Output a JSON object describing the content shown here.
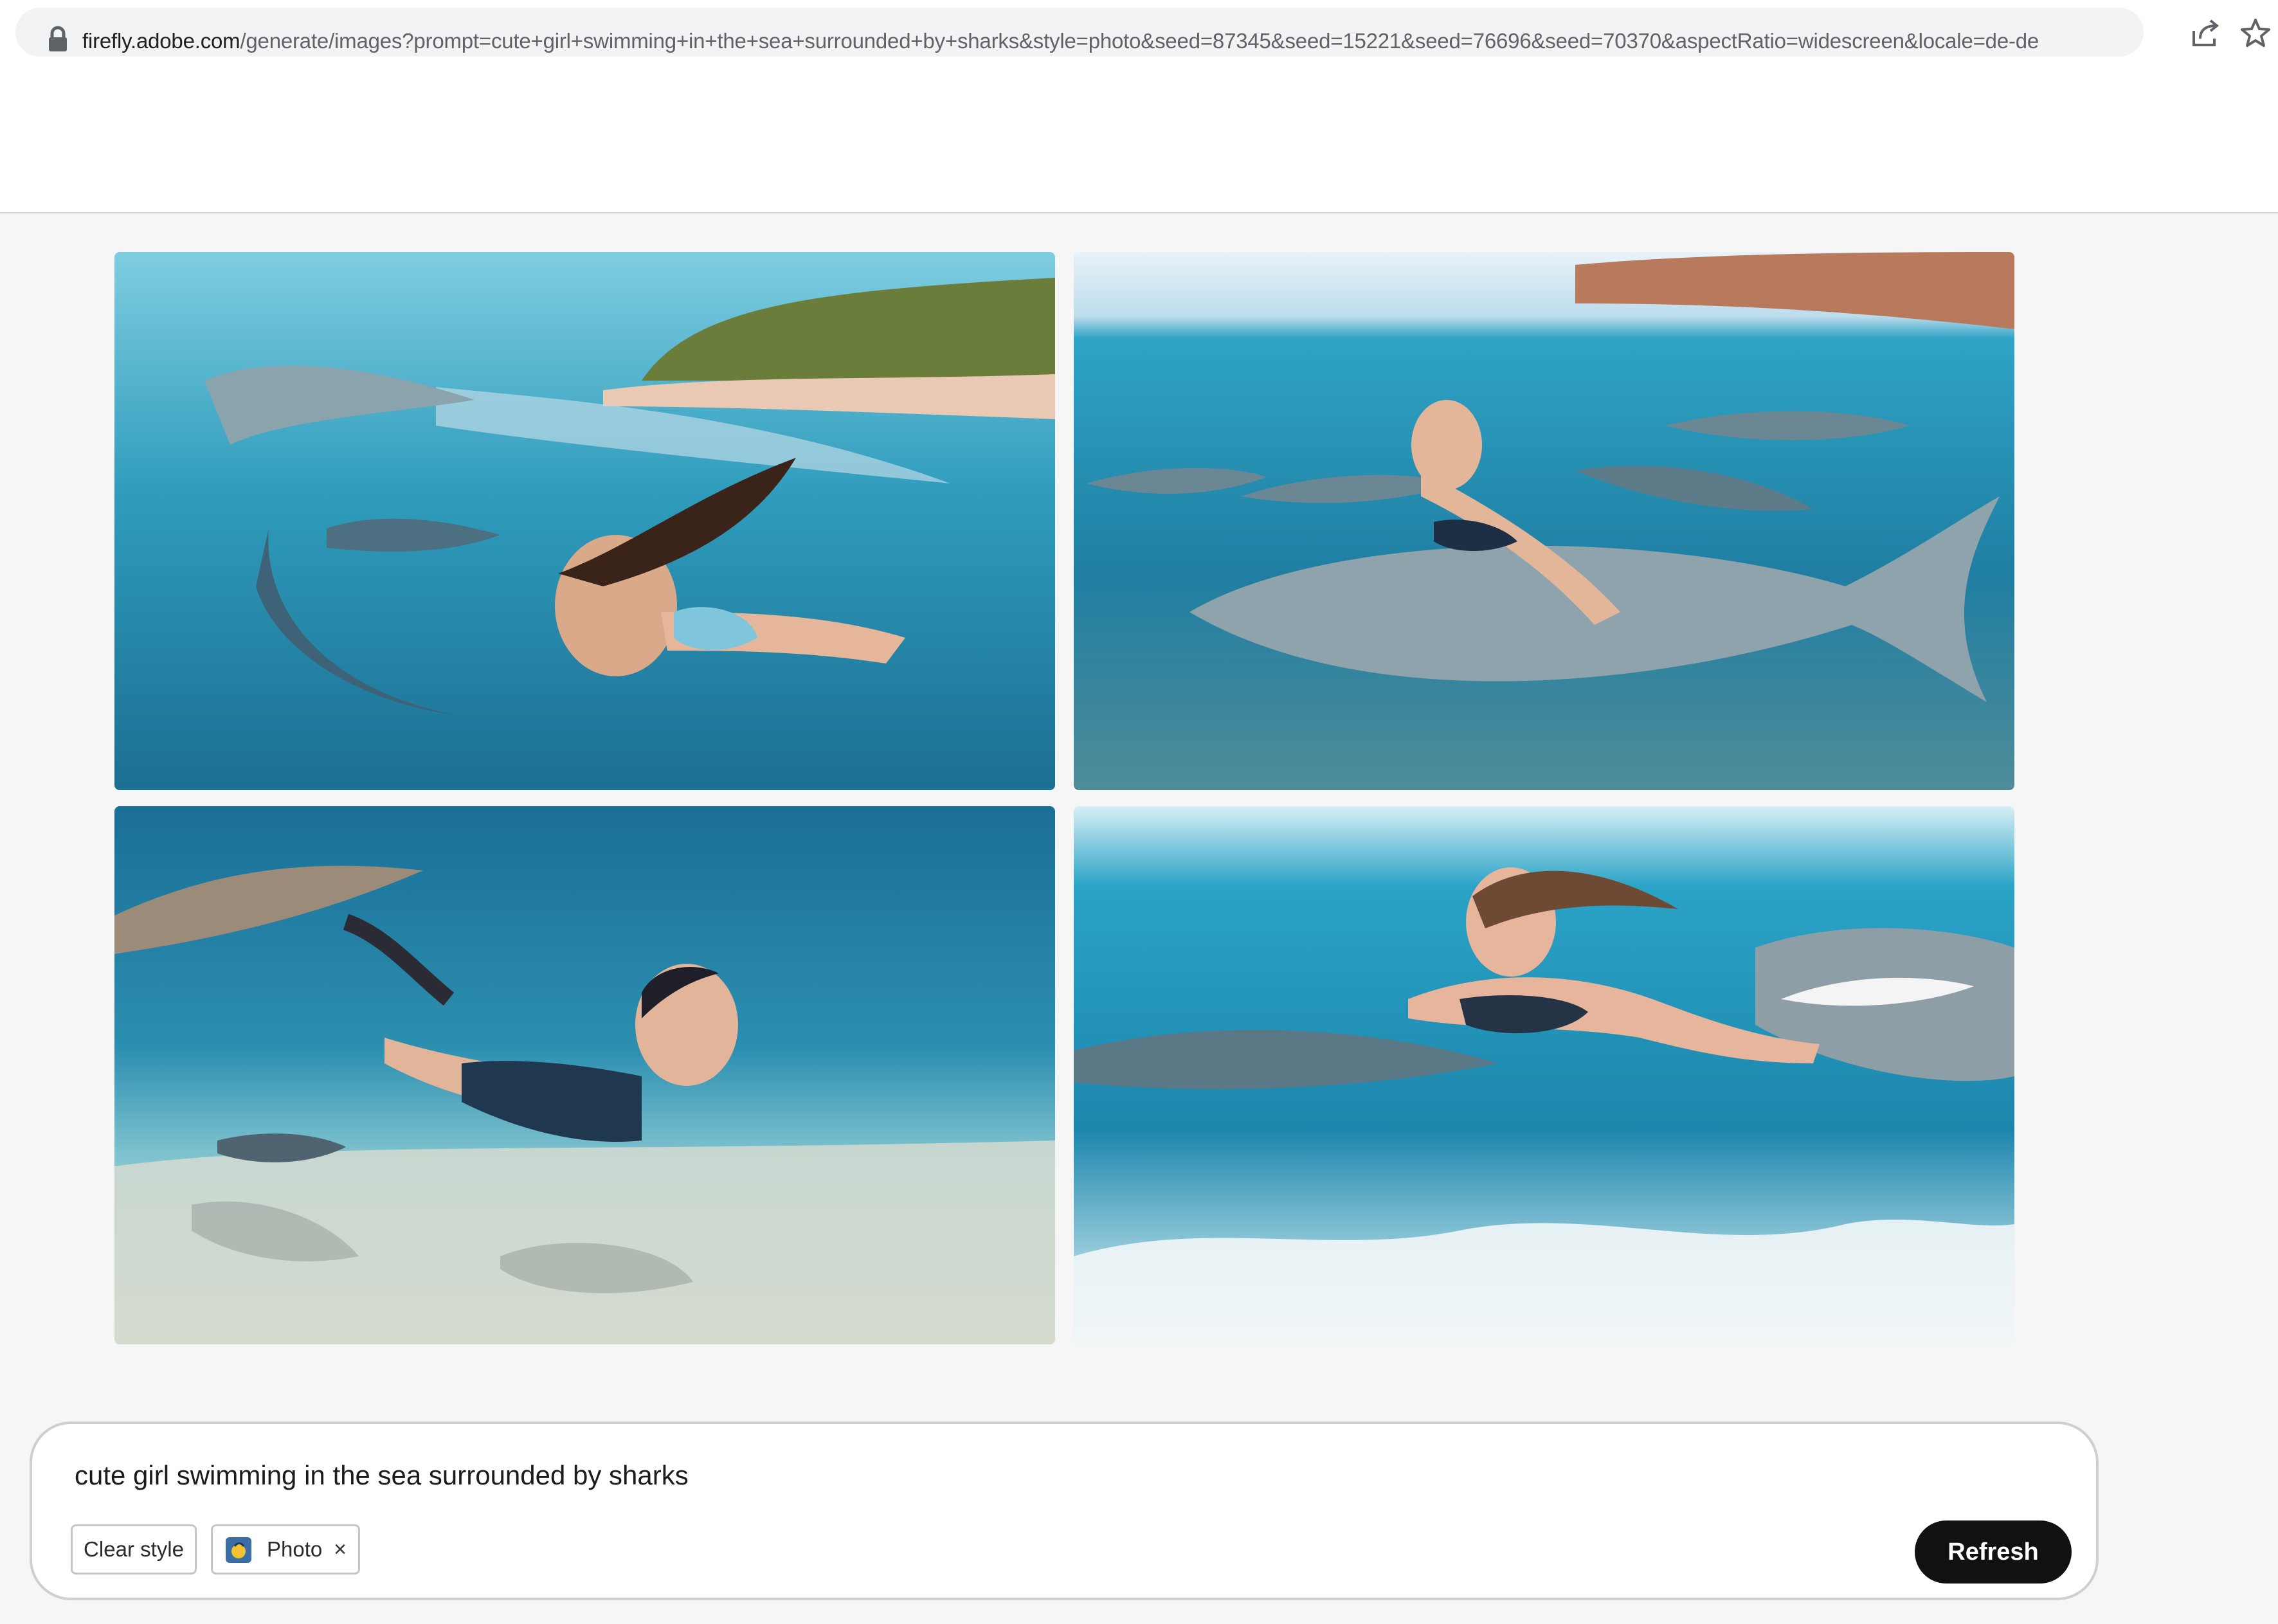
{
  "browser": {
    "url_host": "firefly.adobe.com",
    "url_path": "/generate/images?prompt=cute+girl+swimming+in+the+sea+surrounded+by+sharks&style=photo&seed=87345&seed=15221&seed=76696&seed=70370&aspectRatio=widescreen&locale=de-de",
    "icons": [
      "lock-icon",
      "share-icon",
      "bookmark-star-icon"
    ]
  },
  "gallery": {
    "images": [
      {
        "name": "generated-image-1",
        "subject": "girl swimming with sharks near shore"
      },
      {
        "name": "generated-image-2",
        "subject": "smiling woman riding large shark"
      },
      {
        "name": "generated-image-3",
        "subject": "girl swimming over sandy seabed with sharks"
      },
      {
        "name": "generated-image-4",
        "subject": "woman swimming with great white sharks"
      }
    ]
  },
  "prompt_panel": {
    "prompt": "cute girl swimming in the sea surrounded by sharks",
    "clear_style_label": "Clear style",
    "style_chip_label": "Photo",
    "style_chip_close": "×",
    "refresh_label": "Refresh"
  },
  "colors": {
    "page_bg": "#f6f6f6",
    "ocean_light": "#3fb6c8",
    "ocean_dark": "#0e5a78",
    "refresh_bg": "#111111"
  }
}
